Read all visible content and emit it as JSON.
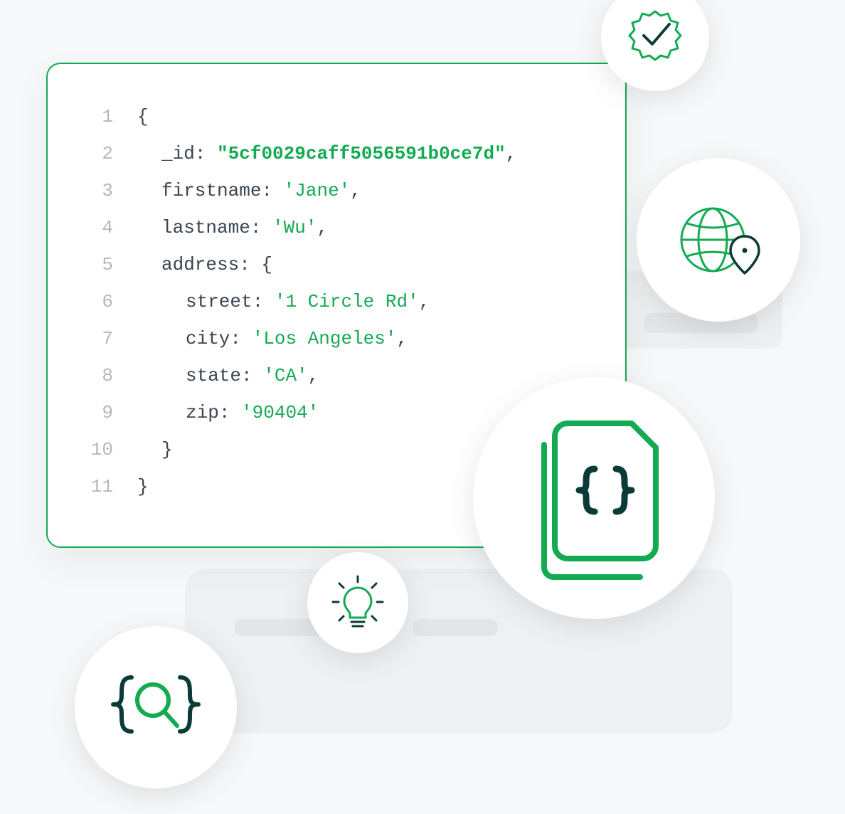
{
  "code": {
    "lines": [
      {
        "n": "1",
        "indent": 1,
        "parts": [
          {
            "t": "punc",
            "v": "{"
          }
        ]
      },
      {
        "n": "2",
        "indent": 2,
        "parts": [
          {
            "t": "key",
            "v": "_id"
          },
          {
            "t": "punc",
            "v": ": "
          },
          {
            "t": "dstr",
            "v": "\"5cf0029caff5056591b0ce7d\""
          },
          {
            "t": "punc",
            "v": ","
          }
        ]
      },
      {
        "n": "3",
        "indent": 2,
        "parts": [
          {
            "t": "key",
            "v": "firstname"
          },
          {
            "t": "punc",
            "v": ": "
          },
          {
            "t": "str",
            "v": "'Jane'"
          },
          {
            "t": "punc",
            "v": ","
          }
        ]
      },
      {
        "n": "4",
        "indent": 2,
        "parts": [
          {
            "t": "key",
            "v": "lastname"
          },
          {
            "t": "punc",
            "v": ": "
          },
          {
            "t": "str",
            "v": "'Wu'"
          },
          {
            "t": "punc",
            "v": ","
          }
        ]
      },
      {
        "n": "5",
        "indent": 2,
        "parts": [
          {
            "t": "key",
            "v": "address"
          },
          {
            "t": "punc",
            "v": ": {"
          }
        ]
      },
      {
        "n": "6",
        "indent": 3,
        "parts": [
          {
            "t": "key",
            "v": "street"
          },
          {
            "t": "punc",
            "v": ": "
          },
          {
            "t": "str",
            "v": "'1 Circle Rd'"
          },
          {
            "t": "punc",
            "v": ","
          }
        ]
      },
      {
        "n": "7",
        "indent": 3,
        "parts": [
          {
            "t": "key",
            "v": "city"
          },
          {
            "t": "punc",
            "v": ": "
          },
          {
            "t": "str",
            "v": "'Los Angeles'"
          },
          {
            "t": "punc",
            "v": ","
          }
        ]
      },
      {
        "n": "8",
        "indent": 3,
        "parts": [
          {
            "t": "key",
            "v": "state"
          },
          {
            "t": "punc",
            "v": ": "
          },
          {
            "t": "str",
            "v": "'CA'"
          },
          {
            "t": "punc",
            "v": ","
          }
        ]
      },
      {
        "n": "9",
        "indent": 3,
        "parts": [
          {
            "t": "key",
            "v": "zip"
          },
          {
            "t": "punc",
            "v": ": "
          },
          {
            "t": "str",
            "v": "'90404'"
          }
        ]
      },
      {
        "n": "10",
        "indent": 2,
        "parts": [
          {
            "t": "punc",
            "v": "}"
          }
        ]
      },
      {
        "n": "11",
        "indent": 1,
        "parts": [
          {
            "t": "punc",
            "v": "}"
          }
        ]
      }
    ]
  },
  "icons": {
    "check": "verified-checkmark-icon",
    "globe": "globe-location-icon",
    "doc": "json-documents-icon",
    "bulb": "lightbulb-idea-icon",
    "search": "json-search-icon"
  },
  "colors": {
    "accent": "#13aa52",
    "dark": "#0b3b36"
  }
}
